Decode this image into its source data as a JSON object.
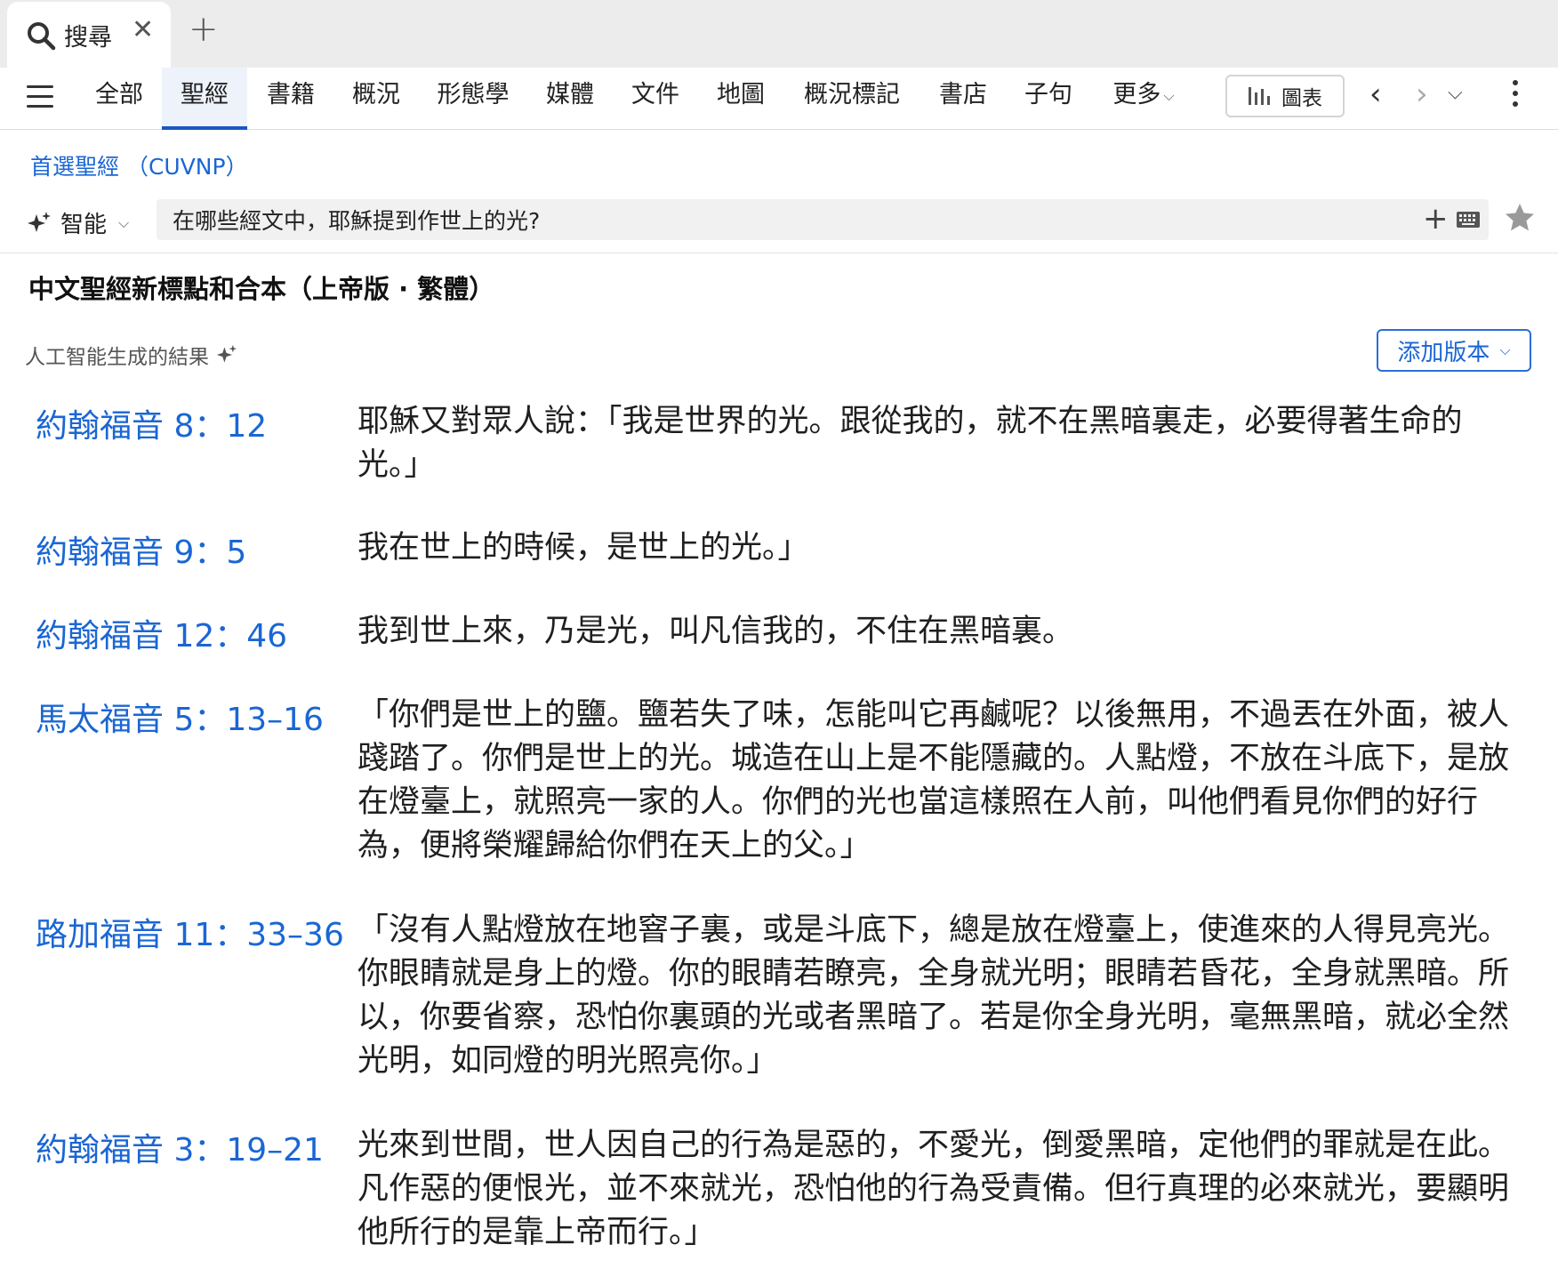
{
  "tab": {
    "title": "搜尋",
    "close": "✕",
    "new": "+"
  },
  "nav": {
    "items": [
      "全部",
      "聖經",
      "書籍",
      "概況",
      "形態學",
      "媒體",
      "文件",
      "地圖",
      "概況標記",
      "書店",
      "子句"
    ],
    "more": "更多",
    "active_index": 1,
    "chart_label": "圖表",
    "back": "‹",
    "forward": "›"
  },
  "search": {
    "preferred_bible": "首選聖經 （CUVNP）",
    "mode": "智能",
    "query": "在哪些經文中，耶穌提到作世上的光?",
    "plus": "+"
  },
  "results": {
    "bible_name": "中文聖經新標點和合本（上帝版 · 繁體）",
    "ai_generated": "人工智能生成的結果",
    "add_version": "添加版本",
    "items": [
      {
        "ref": "約翰福音 8：12",
        "text": "耶穌又對眾人說：「我是世界的光。跟從我的，就不在黑暗裏走，必要得著生命的光。」"
      },
      {
        "ref": "約翰福音 9：5",
        "text": "我在世上的時候，是世上的光。」"
      },
      {
        "ref": "約翰福音 12：46",
        "text": "我到世上來，乃是光，叫凡信我的，不住在黑暗裏。"
      },
      {
        "ref": "馬太福音 5：13–16",
        "text": "「你們是世上的鹽。鹽若失了味，怎能叫它再鹹呢？以後無用，不過丟在外面，被人踐踏了。你們是世上的光。城造在山上是不能隱藏的。人點燈，不放在斗底下，是放在燈臺上，就照亮一家的人。你們的光也當這樣照在人前，叫他們看見你們的好行為，便將榮耀歸給你們在天上的父。」"
      },
      {
        "ref": "路加福音 11：33–36",
        "text": "「沒有人點燈放在地窨子裏，或是斗底下，總是放在燈臺上，使進來的人得見亮光。你眼睛就是身上的燈。你的眼睛若瞭亮，全身就光明；眼睛若昏花，全身就黑暗。所以，你要省察，恐怕你裏頭的光或者黑暗了。若是你全身光明，毫無黑暗，就必全然光明，如同燈的明光照亮你。」"
      },
      {
        "ref": "約翰福音 3：19–21",
        "text": "光來到世間，世人因自己的行為是惡的，不愛光，倒愛黑暗，定他們的罪就是在此。凡作惡的便恨光，並不來就光，恐怕他的行為受責備。但行真理的必來就光，要顯明他所行的是靠上帝而行。」"
      }
    ]
  },
  "colors": {
    "accent": "#1a66d4",
    "active_tab_bg": "#eef3fb",
    "tabstrip_bg": "#ececec"
  }
}
